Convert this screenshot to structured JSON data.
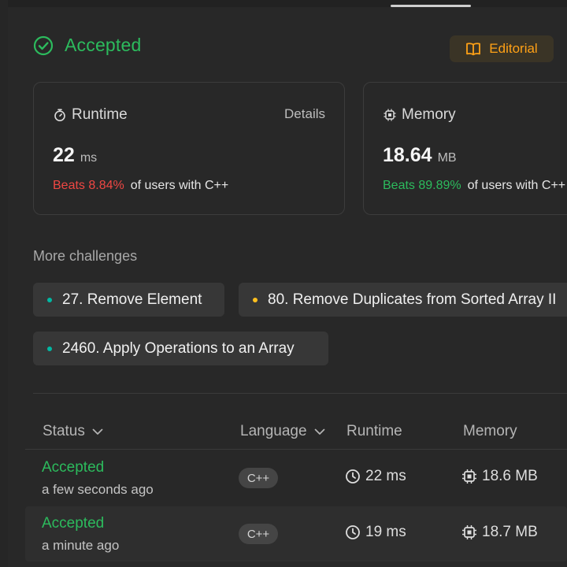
{
  "result": {
    "title": "Accepted",
    "editorial_label": "Editorial"
  },
  "runtime": {
    "label": "Runtime",
    "details_label": "Details",
    "value": "22",
    "unit": "ms",
    "beats": "Beats 8.84%",
    "beats_tail": "of users with C++"
  },
  "memory": {
    "label": "Memory",
    "value": "18.64",
    "unit": "MB",
    "beats": "Beats 89.89%",
    "beats_tail": "of users with C++"
  },
  "challenges": {
    "title": "More challenges",
    "items": [
      {
        "label": "27. Remove Element",
        "difficulty_color": "#00b8a3"
      },
      {
        "label": "80. Remove Duplicates from Sorted Array II",
        "difficulty_color": "#ffc01e"
      },
      {
        "label": "2460. Apply Operations to an Array",
        "difficulty_color": "#00b8a3"
      }
    ]
  },
  "submissions": {
    "columns": {
      "status": "Status",
      "language": "Language",
      "runtime": "Runtime",
      "memory": "Memory"
    },
    "rows": [
      {
        "status": "Accepted",
        "time": "a few seconds ago",
        "language": "C++",
        "runtime": "22 ms",
        "memory": "18.6 MB"
      },
      {
        "status": "Accepted",
        "time": "a minute ago",
        "language": "C++",
        "runtime": "19 ms",
        "memory": "18.7 MB"
      }
    ]
  },
  "colors": {
    "accepted": "#2cbb5d",
    "editorial": "#ffa116",
    "beats_low": "#ef4743",
    "beats_high": "#2cbb5d"
  }
}
